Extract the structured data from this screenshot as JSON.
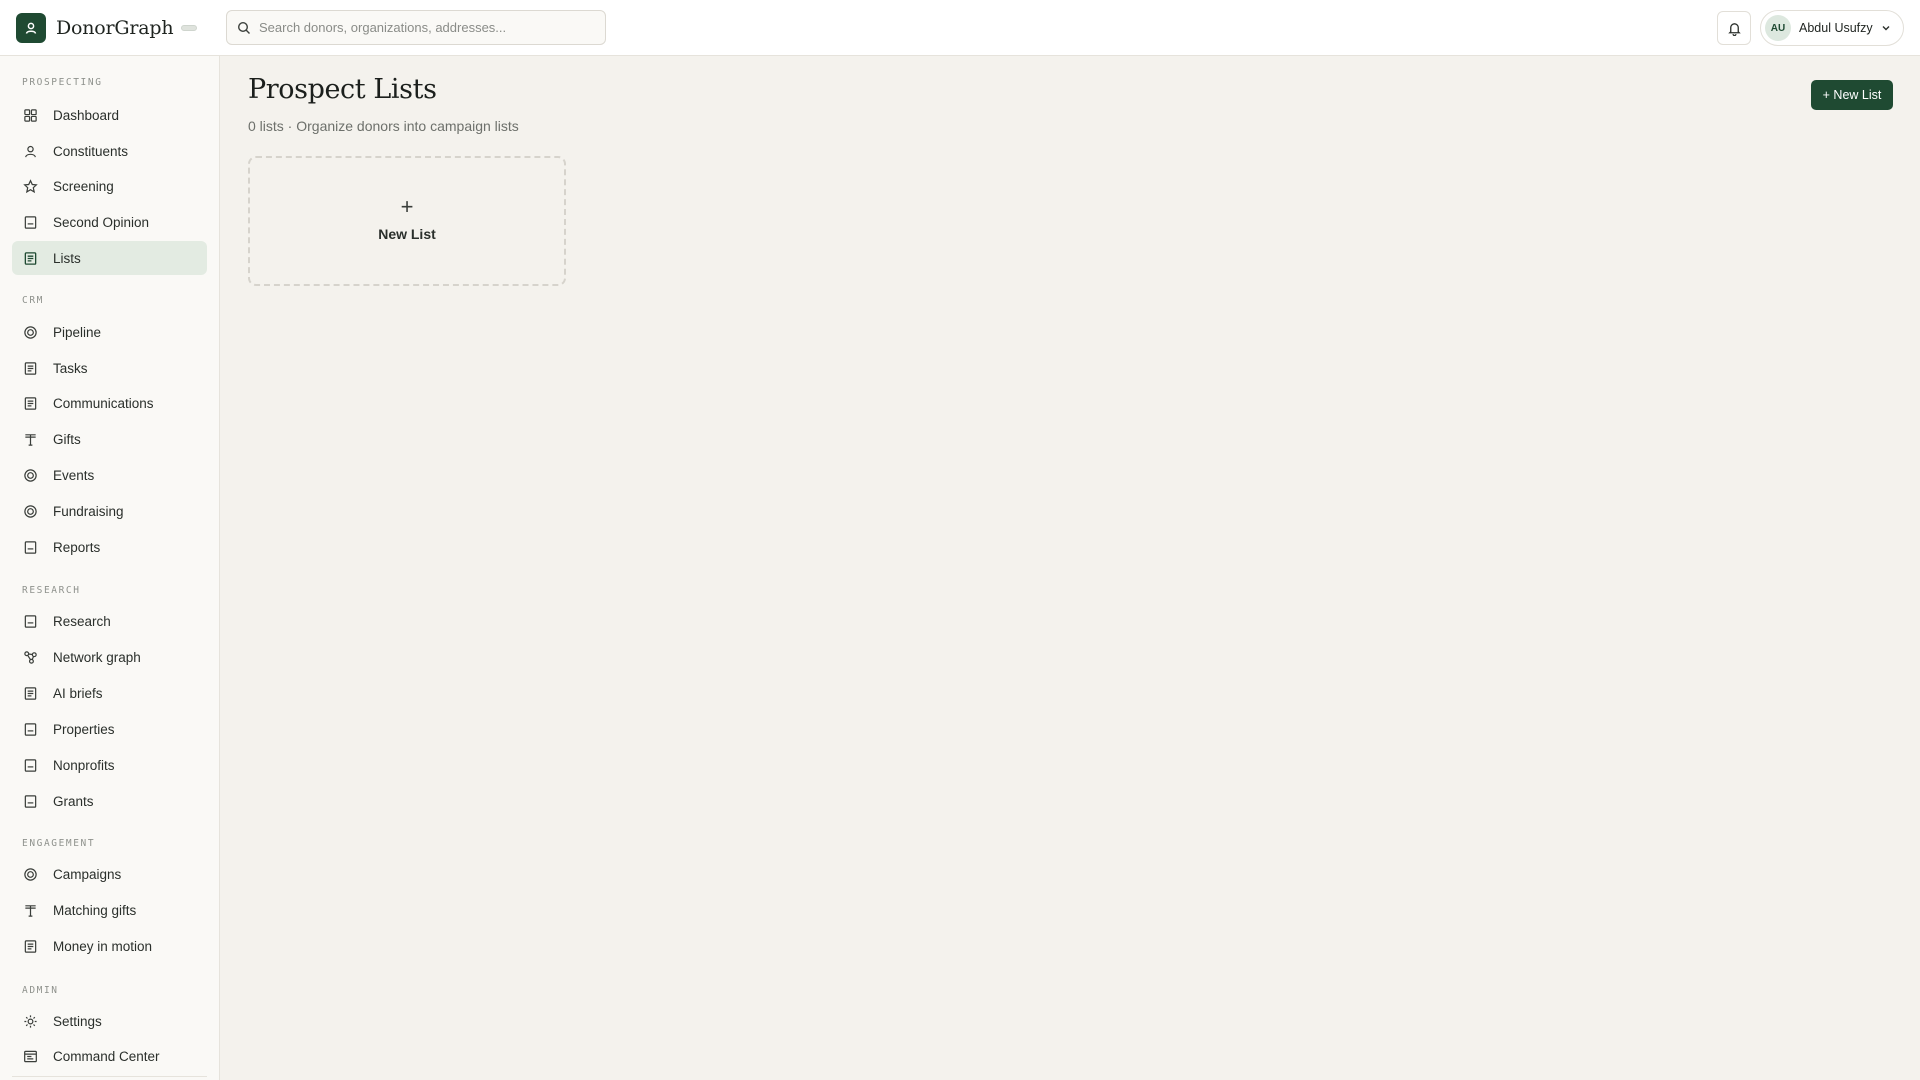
{
  "app": {
    "brand_name": "DonorGraph"
  },
  "search": {
    "placeholder": "Search donors, organizations, addresses..."
  },
  "user": {
    "initials": "AU",
    "name": "Abdul Usufzy"
  },
  "sidebar": {
    "sections": [
      {
        "label": "PROSPECTING",
        "items": [
          {
            "label": "Dashboard",
            "icon": "grid-icon"
          },
          {
            "label": "Constituents",
            "icon": "person-icon"
          },
          {
            "label": "Screening",
            "icon": "star-icon"
          },
          {
            "label": "Second Opinion",
            "icon": "document-icon"
          },
          {
            "label": "Lists",
            "icon": "list-icon",
            "active": true
          }
        ]
      },
      {
        "label": "CRM",
        "items": [
          {
            "label": "Pipeline",
            "icon": "target-icon"
          },
          {
            "label": "Tasks",
            "icon": "list-icon"
          },
          {
            "label": "Communications",
            "icon": "list-icon"
          },
          {
            "label": "Gifts",
            "icon": "gift-icon"
          },
          {
            "label": "Events",
            "icon": "target-icon"
          },
          {
            "label": "Fundraising",
            "icon": "target-icon"
          },
          {
            "label": "Reports",
            "icon": "document-icon"
          }
        ]
      },
      {
        "label": "RESEARCH",
        "items": [
          {
            "label": "Research",
            "icon": "document-icon"
          },
          {
            "label": "Network graph",
            "icon": "network-icon"
          },
          {
            "label": "AI briefs",
            "icon": "list-icon"
          },
          {
            "label": "Properties",
            "icon": "document-icon"
          },
          {
            "label": "Nonprofits",
            "icon": "document-icon"
          },
          {
            "label": "Grants",
            "icon": "document-icon"
          }
        ]
      },
      {
        "label": "ENGAGEMENT",
        "items": [
          {
            "label": "Campaigns",
            "icon": "target-icon"
          },
          {
            "label": "Matching gifts",
            "icon": "gift-icon"
          },
          {
            "label": "Money in motion",
            "icon": "list-icon"
          }
        ]
      },
      {
        "label": "ADMIN",
        "items": [
          {
            "label": "Settings",
            "icon": "gear-icon"
          },
          {
            "label": "Command Center",
            "icon": "terminal-icon"
          }
        ]
      }
    ]
  },
  "main": {
    "title": "Prospect Lists",
    "subtitle": "0 lists · Organize donors into campaign lists",
    "new_list_button": "+ New List",
    "new_list_card": {
      "plus": "+",
      "label": "New List"
    }
  },
  "colors": {
    "accent": "#1f4a32",
    "background": "#f4f2ed",
    "sidebar_bg": "#faf9f6",
    "active_item_bg": "#e3ebe2"
  }
}
